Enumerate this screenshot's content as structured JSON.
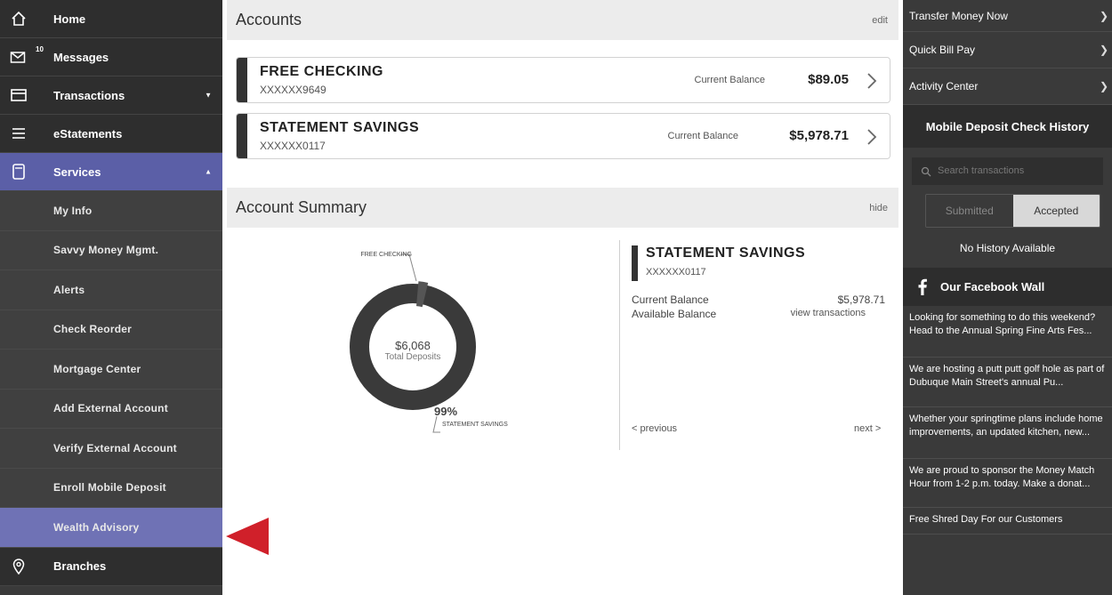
{
  "sidebar": {
    "items": [
      {
        "label": "Home",
        "icon": "home-icon"
      },
      {
        "label": "Messages",
        "icon": "mail-icon",
        "badge": "10"
      },
      {
        "label": "Transactions",
        "icon": "card-icon"
      },
      {
        "label": "eStatements",
        "icon": "list-icon"
      },
      {
        "label": "Services",
        "icon": "device-icon"
      }
    ],
    "sub_items": [
      "My Info",
      "Savvy Money Mgmt.",
      "Alerts",
      "Check Reorder",
      "Mortgage Center",
      "Add External Account",
      "Verify External Account",
      "Enroll Mobile Deposit",
      "Wealth Advisory"
    ],
    "bottom_item": {
      "label": "Branches",
      "icon": "location-pin-icon"
    }
  },
  "accounts": {
    "title": "Accounts",
    "edit_label": "edit",
    "list": [
      {
        "name": "FREE CHECKING",
        "number": "XXXXXX9649",
        "balance_label": "Current Balance",
        "balance": "$89.05"
      },
      {
        "name": "STATEMENT SAVINGS",
        "number": "XXXXXX0117",
        "balance_label": "Current Balance",
        "balance": "$5,978.71"
      }
    ]
  },
  "summary": {
    "title": "Account Summary",
    "hide_label": "hide",
    "donut": {
      "total": "$6,068",
      "total_label": "Total Deposits",
      "checking_label": "FREE CHECKING",
      "savings_label": "STATEMENT SAVINGS",
      "savings_pct": "99%",
      "checking_fraction": 0.0147,
      "colors": {
        "savings": "#3a3a3a",
        "checking": "#555555"
      }
    },
    "detail": {
      "name": "STATEMENT SAVINGS",
      "number": "XXXXXX0117",
      "current_label": "Current Balance",
      "current_value": "$5,978.71",
      "available_label": "Available Balance",
      "available_link": "view transactions"
    },
    "prev_label": "< previous",
    "next_label": "next >"
  },
  "right_panel": {
    "quick_links": [
      "Transfer Money Now",
      "Quick Bill Pay",
      "Activity Center"
    ],
    "deposit_heading": "Mobile Deposit Check History",
    "search_placeholder": "Search transactions",
    "tabs": {
      "submitted": "Submitted",
      "accepted": "Accepted"
    },
    "no_history": "No History Available",
    "facebook_heading": "Our Facebook Wall",
    "posts": [
      "Looking for something to do this weekend? Head to the Annual Spring Fine Arts Fes...",
      "We are hosting a putt putt golf hole as part of Dubuque Main Street's annual Pu...",
      "Whether your springtime plans include home improvements, an updated kitchen, new...",
      "We are proud to sponsor the Money Match Hour from 1-2 p.m. today. Make a donat...",
      "Free Shred Day For our Customers"
    ]
  },
  "colors": {
    "sidebar_bg": "#3a3a3a",
    "services_active": "#5b5fa7",
    "wealth_highlight": "#6f72b5",
    "pointer_red": "#d0202a"
  }
}
